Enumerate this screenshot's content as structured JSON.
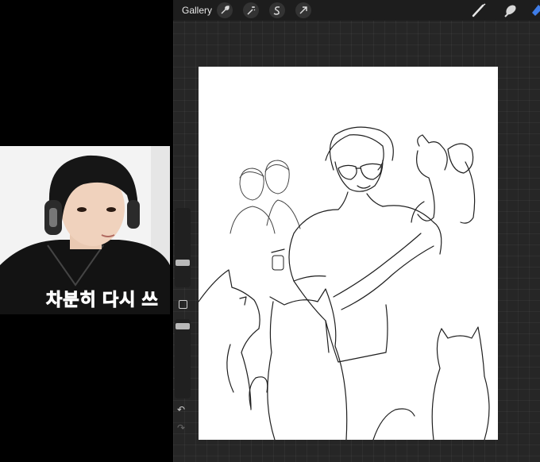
{
  "toolbar": {
    "gallery_label": "Gallery",
    "left_tools": [
      "wrench-icon",
      "magic-wand-icon",
      "selection-icon",
      "transform-arrow-icon"
    ],
    "right_tools": [
      "brush-icon",
      "smudge-icon",
      "eraser-icon"
    ]
  },
  "sidebar": {
    "brush_size_level": 0.25,
    "opacity_level": 0.05,
    "modify_icon": "square-icon",
    "undo_icon": "undo-arrow-icon",
    "redo_icon": "redo-arrow-icon"
  },
  "webcam": {
    "caption_part1": "차분히",
    "caption_part2": "다시 쓰",
    "caption_color1": "#1c2a66",
    "caption_color2": "#2a8bd8"
  },
  "colors": {
    "app_bg": "#262626",
    "toolbar_bg": "#1d1d1d",
    "canvas_bg": "#ffffff"
  }
}
